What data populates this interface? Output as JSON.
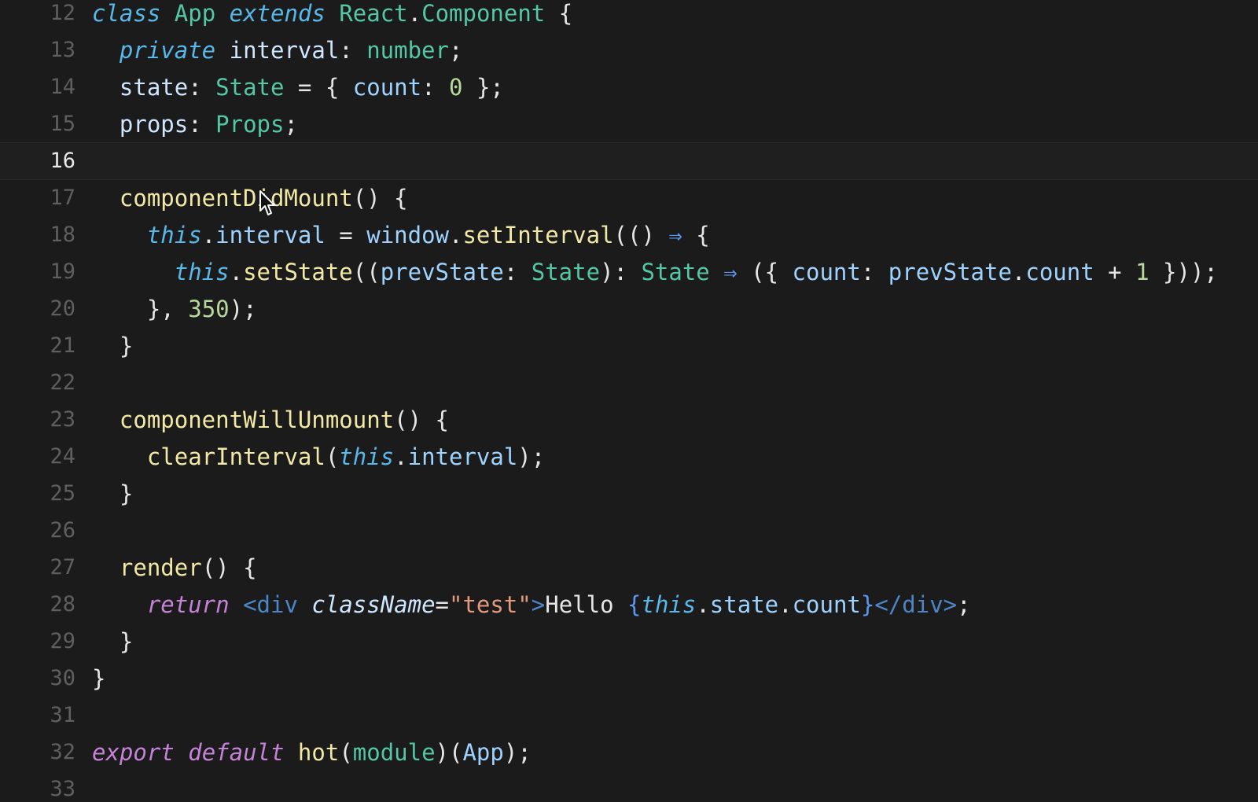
{
  "colors": {
    "background": "#1b1b1b",
    "keyword_italic": "#57b9e9",
    "class_name": "#54c7a6",
    "property": "#9fd3ff",
    "method": "#f3e9a6",
    "punct": "#e6e6e6",
    "number": "#b7d99c",
    "string": "#e39a7c",
    "purple_keyword": "#c583d8",
    "arrow": "#5a97f0",
    "jsx_tag": "#4c86c7",
    "attr": "#cfe6ff",
    "gutter": "#5f5f5f"
  },
  "editor": {
    "current_line": "16",
    "lines": [
      {
        "num": "12",
        "tokens": [
          {
            "t": "class",
            "c": "#57b9e9",
            "i": true
          },
          {
            "t": " "
          },
          {
            "t": "App",
            "c": "#54c7a6"
          },
          {
            "t": " "
          },
          {
            "t": "extends",
            "c": "#57b9e9",
            "i": true
          },
          {
            "t": " "
          },
          {
            "t": "React",
            "c": "#54c7a6"
          },
          {
            "t": ".",
            "c": "#e6e6e6"
          },
          {
            "t": "Component",
            "c": "#54c7a6"
          },
          {
            "t": " {",
            "c": "#e6e6e6"
          }
        ]
      },
      {
        "num": "13",
        "tokens": [
          {
            "t": "  "
          },
          {
            "t": "private",
            "c": "#57b9e9",
            "i": true
          },
          {
            "t": " "
          },
          {
            "t": "interval",
            "c": "#cfe6ff"
          },
          {
            "t": ": ",
            "c": "#e6e6e6"
          },
          {
            "t": "number",
            "c": "#54c7a6"
          },
          {
            "t": ";",
            "c": "#e6e6e6"
          }
        ]
      },
      {
        "num": "14",
        "tokens": [
          {
            "t": "  "
          },
          {
            "t": "state",
            "c": "#cfe6ff"
          },
          {
            "t": ": ",
            "c": "#e6e6e6"
          },
          {
            "t": "State",
            "c": "#54c7a6"
          },
          {
            "t": " = { ",
            "c": "#e6e6e6"
          },
          {
            "t": "count",
            "c": "#9fd3ff"
          },
          {
            "t": ": ",
            "c": "#e6e6e6"
          },
          {
            "t": "0",
            "c": "#b7d99c"
          },
          {
            "t": " };",
            "c": "#e6e6e6"
          }
        ]
      },
      {
        "num": "15",
        "tokens": [
          {
            "t": "  "
          },
          {
            "t": "props",
            "c": "#cfe6ff"
          },
          {
            "t": ": ",
            "c": "#e6e6e6"
          },
          {
            "t": "Props",
            "c": "#54c7a6"
          },
          {
            "t": ";",
            "c": "#e6e6e6"
          }
        ]
      },
      {
        "num": "16",
        "tokens": []
      },
      {
        "num": "17",
        "tokens": [
          {
            "t": "  "
          },
          {
            "t": "componentDidMount",
            "c": "#f3e9a6"
          },
          {
            "t": "() {",
            "c": "#e6e6e6"
          }
        ]
      },
      {
        "num": "18",
        "tokens": [
          {
            "t": "    "
          },
          {
            "t": "this",
            "c": "#57b9e9",
            "i": true
          },
          {
            "t": ".",
            "c": "#e6e6e6"
          },
          {
            "t": "interval",
            "c": "#9fd3ff"
          },
          {
            "t": " = ",
            "c": "#e6e6e6"
          },
          {
            "t": "window",
            "c": "#9fd3ff"
          },
          {
            "t": ".",
            "c": "#e6e6e6"
          },
          {
            "t": "setInterval",
            "c": "#f3e9a6"
          },
          {
            "t": "(() ",
            "c": "#e6e6e6"
          },
          {
            "t": "⇒",
            "c": "#5a97f0"
          },
          {
            "t": " {",
            "c": "#e6e6e6"
          }
        ]
      },
      {
        "num": "19",
        "tokens": [
          {
            "t": "      "
          },
          {
            "t": "this",
            "c": "#57b9e9",
            "i": true
          },
          {
            "t": ".",
            "c": "#e6e6e6"
          },
          {
            "t": "setState",
            "c": "#f3e9a6"
          },
          {
            "t": "((",
            "c": "#e6e6e6"
          },
          {
            "t": "prevState",
            "c": "#9fd3ff"
          },
          {
            "t": ": ",
            "c": "#e6e6e6"
          },
          {
            "t": "State",
            "c": "#54c7a6"
          },
          {
            "t": "): ",
            "c": "#e6e6e6"
          },
          {
            "t": "State",
            "c": "#54c7a6"
          },
          {
            "t": " "
          },
          {
            "t": "⇒",
            "c": "#5a97f0"
          },
          {
            "t": " ({ ",
            "c": "#e6e6e6"
          },
          {
            "t": "count",
            "c": "#9fd3ff"
          },
          {
            "t": ": ",
            "c": "#e6e6e6"
          },
          {
            "t": "prevState",
            "c": "#9fd3ff"
          },
          {
            "t": ".",
            "c": "#e6e6e6"
          },
          {
            "t": "count",
            "c": "#9fd3ff"
          },
          {
            "t": " + ",
            "c": "#e6e6e6"
          },
          {
            "t": "1",
            "c": "#b7d99c"
          },
          {
            "t": " }));",
            "c": "#e6e6e6"
          }
        ]
      },
      {
        "num": "20",
        "tokens": [
          {
            "t": "    "
          },
          {
            "t": "}, ",
            "c": "#e6e6e6"
          },
          {
            "t": "350",
            "c": "#b7d99c"
          },
          {
            "t": ");",
            "c": "#e6e6e6"
          }
        ]
      },
      {
        "num": "21",
        "tokens": [
          {
            "t": "  "
          },
          {
            "t": "}",
            "c": "#e6e6e6"
          }
        ]
      },
      {
        "num": "22",
        "tokens": []
      },
      {
        "num": "23",
        "tokens": [
          {
            "t": "  "
          },
          {
            "t": "componentWillUnmount",
            "c": "#f3e9a6"
          },
          {
            "t": "() {",
            "c": "#e6e6e6"
          }
        ]
      },
      {
        "num": "24",
        "tokens": [
          {
            "t": "    "
          },
          {
            "t": "clearInterval",
            "c": "#f3e9a6"
          },
          {
            "t": "(",
            "c": "#e6e6e6"
          },
          {
            "t": "this",
            "c": "#57b9e9",
            "i": true
          },
          {
            "t": ".",
            "c": "#e6e6e6"
          },
          {
            "t": "interval",
            "c": "#9fd3ff"
          },
          {
            "t": ");",
            "c": "#e6e6e6"
          }
        ]
      },
      {
        "num": "25",
        "tokens": [
          {
            "t": "  "
          },
          {
            "t": "}",
            "c": "#e6e6e6"
          }
        ]
      },
      {
        "num": "26",
        "tokens": []
      },
      {
        "num": "27",
        "tokens": [
          {
            "t": "  "
          },
          {
            "t": "render",
            "c": "#f3e9a6"
          },
          {
            "t": "() {",
            "c": "#e6e6e6"
          }
        ]
      },
      {
        "num": "28",
        "tokens": [
          {
            "t": "    "
          },
          {
            "t": "return",
            "c": "#c583d8",
            "i": true
          },
          {
            "t": " "
          },
          {
            "t": "<",
            "c": "#4c86c7"
          },
          {
            "t": "div",
            "c": "#4c86c7"
          },
          {
            "t": " "
          },
          {
            "t": "className",
            "c": "#cfe6ff",
            "i": true
          },
          {
            "t": "=",
            "c": "#e6e6e6"
          },
          {
            "t": "\"test\"",
            "c": "#e39a7c"
          },
          {
            "t": ">",
            "c": "#4c86c7"
          },
          {
            "t": "Hello ",
            "c": "#e6e6e6"
          },
          {
            "t": "{",
            "c": "#5a97f0"
          },
          {
            "t": "this",
            "c": "#57b9e9",
            "i": true
          },
          {
            "t": ".",
            "c": "#e6e6e6"
          },
          {
            "t": "state",
            "c": "#9fd3ff"
          },
          {
            "t": ".",
            "c": "#e6e6e6"
          },
          {
            "t": "count",
            "c": "#9fd3ff"
          },
          {
            "t": "}",
            "c": "#5a97f0"
          },
          {
            "t": "</",
            "c": "#4c86c7"
          },
          {
            "t": "div",
            "c": "#4c86c7"
          },
          {
            "t": ">",
            "c": "#4c86c7"
          },
          {
            "t": ";",
            "c": "#e6e6e6"
          }
        ]
      },
      {
        "num": "29",
        "tokens": [
          {
            "t": "  "
          },
          {
            "t": "}",
            "c": "#e6e6e6"
          }
        ]
      },
      {
        "num": "30",
        "tokens": [
          {
            "t": "}",
            "c": "#e6e6e6"
          }
        ]
      },
      {
        "num": "31",
        "tokens": []
      },
      {
        "num": "32",
        "tokens": [
          {
            "t": "export",
            "c": "#c583d8",
            "i": true
          },
          {
            "t": " "
          },
          {
            "t": "default",
            "c": "#c583d8",
            "i": true
          },
          {
            "t": " "
          },
          {
            "t": "hot",
            "c": "#f3e9a6"
          },
          {
            "t": "(",
            "c": "#e6e6e6"
          },
          {
            "t": "module",
            "c": "#54c7a6"
          },
          {
            "t": ")(",
            "c": "#e6e6e6"
          },
          {
            "t": "App",
            "c": "#9fd3ff"
          },
          {
            "t": ");",
            "c": "#e6e6e6"
          }
        ]
      },
      {
        "num": "33",
        "tokens": []
      }
    ]
  }
}
